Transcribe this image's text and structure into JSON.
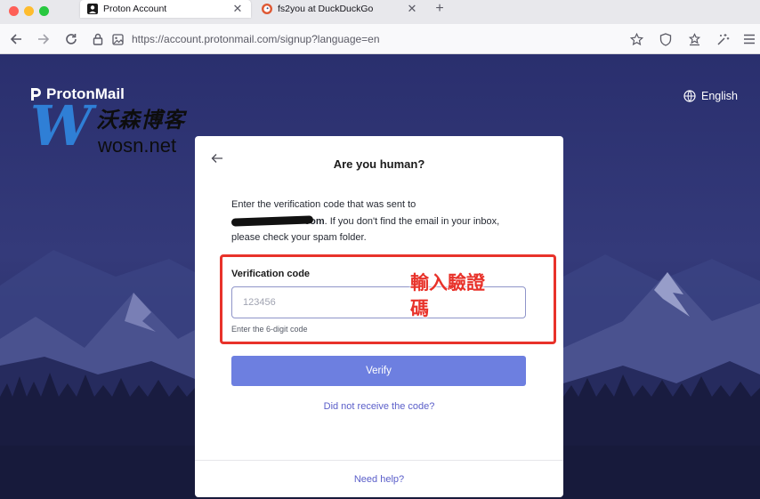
{
  "browser": {
    "tabs": [
      {
        "title": "Proton Account",
        "close": "✕",
        "icon": "user-silhouette-icon",
        "active": true
      },
      {
        "title": "fs2you at DuckDuckGo",
        "close": "✕",
        "icon": "duckduckgo-icon",
        "active": false
      }
    ],
    "new_tab": "+",
    "url": "https://account.protonmail.com/signup?language=en",
    "colors": {
      "close": "#fe5f57",
      "minimize": "#febc2e",
      "zoom": "#28c840"
    }
  },
  "watermark": {
    "letter": "W",
    "chinese": "沃森博客",
    "domain": "wosn.net"
  },
  "page": {
    "brand": "ProtonMail",
    "language": "English"
  },
  "card": {
    "title": "Are you human?",
    "desc_line1": "Enter the verification code that was sent to",
    "email_suffix": "com",
    "desc_line2_rest": ". If you don't find the email in your inbox,",
    "desc_line3": "please check your spam folder.",
    "field_label": "Verification code",
    "placeholder": "123456",
    "hint": "Enter the 6-digit code",
    "verify": "Verify",
    "resend": "Did not receive the code?",
    "help": "Need help?",
    "accent": "#6d7fe0"
  },
  "annotation": {
    "text": "輸入驗證碼",
    "color": "#e8322a"
  }
}
